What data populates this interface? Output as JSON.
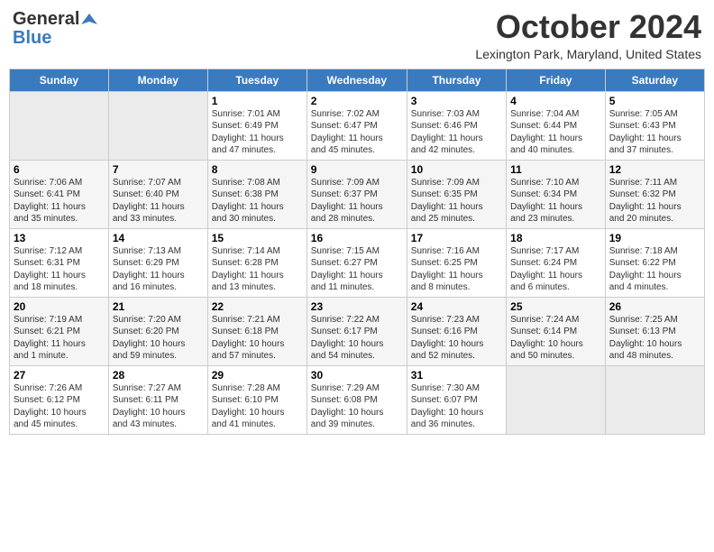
{
  "header": {
    "logo_general": "General",
    "logo_blue": "Blue",
    "month_title": "October 2024",
    "location": "Lexington Park, Maryland, United States"
  },
  "days_of_week": [
    "Sunday",
    "Monday",
    "Tuesday",
    "Wednesday",
    "Thursday",
    "Friday",
    "Saturday"
  ],
  "weeks": [
    [
      {
        "num": "",
        "info": ""
      },
      {
        "num": "",
        "info": ""
      },
      {
        "num": "1",
        "info": "Sunrise: 7:01 AM\nSunset: 6:49 PM\nDaylight: 11 hours\nand 47 minutes."
      },
      {
        "num": "2",
        "info": "Sunrise: 7:02 AM\nSunset: 6:47 PM\nDaylight: 11 hours\nand 45 minutes."
      },
      {
        "num": "3",
        "info": "Sunrise: 7:03 AM\nSunset: 6:46 PM\nDaylight: 11 hours\nand 42 minutes."
      },
      {
        "num": "4",
        "info": "Sunrise: 7:04 AM\nSunset: 6:44 PM\nDaylight: 11 hours\nand 40 minutes."
      },
      {
        "num": "5",
        "info": "Sunrise: 7:05 AM\nSunset: 6:43 PM\nDaylight: 11 hours\nand 37 minutes."
      }
    ],
    [
      {
        "num": "6",
        "info": "Sunrise: 7:06 AM\nSunset: 6:41 PM\nDaylight: 11 hours\nand 35 minutes."
      },
      {
        "num": "7",
        "info": "Sunrise: 7:07 AM\nSunset: 6:40 PM\nDaylight: 11 hours\nand 33 minutes."
      },
      {
        "num": "8",
        "info": "Sunrise: 7:08 AM\nSunset: 6:38 PM\nDaylight: 11 hours\nand 30 minutes."
      },
      {
        "num": "9",
        "info": "Sunrise: 7:09 AM\nSunset: 6:37 PM\nDaylight: 11 hours\nand 28 minutes."
      },
      {
        "num": "10",
        "info": "Sunrise: 7:09 AM\nSunset: 6:35 PM\nDaylight: 11 hours\nand 25 minutes."
      },
      {
        "num": "11",
        "info": "Sunrise: 7:10 AM\nSunset: 6:34 PM\nDaylight: 11 hours\nand 23 minutes."
      },
      {
        "num": "12",
        "info": "Sunrise: 7:11 AM\nSunset: 6:32 PM\nDaylight: 11 hours\nand 20 minutes."
      }
    ],
    [
      {
        "num": "13",
        "info": "Sunrise: 7:12 AM\nSunset: 6:31 PM\nDaylight: 11 hours\nand 18 minutes."
      },
      {
        "num": "14",
        "info": "Sunrise: 7:13 AM\nSunset: 6:29 PM\nDaylight: 11 hours\nand 16 minutes."
      },
      {
        "num": "15",
        "info": "Sunrise: 7:14 AM\nSunset: 6:28 PM\nDaylight: 11 hours\nand 13 minutes."
      },
      {
        "num": "16",
        "info": "Sunrise: 7:15 AM\nSunset: 6:27 PM\nDaylight: 11 hours\nand 11 minutes."
      },
      {
        "num": "17",
        "info": "Sunrise: 7:16 AM\nSunset: 6:25 PM\nDaylight: 11 hours\nand 8 minutes."
      },
      {
        "num": "18",
        "info": "Sunrise: 7:17 AM\nSunset: 6:24 PM\nDaylight: 11 hours\nand 6 minutes."
      },
      {
        "num": "19",
        "info": "Sunrise: 7:18 AM\nSunset: 6:22 PM\nDaylight: 11 hours\nand 4 minutes."
      }
    ],
    [
      {
        "num": "20",
        "info": "Sunrise: 7:19 AM\nSunset: 6:21 PM\nDaylight: 11 hours\nand 1 minute."
      },
      {
        "num": "21",
        "info": "Sunrise: 7:20 AM\nSunset: 6:20 PM\nDaylight: 10 hours\nand 59 minutes."
      },
      {
        "num": "22",
        "info": "Sunrise: 7:21 AM\nSunset: 6:18 PM\nDaylight: 10 hours\nand 57 minutes."
      },
      {
        "num": "23",
        "info": "Sunrise: 7:22 AM\nSunset: 6:17 PM\nDaylight: 10 hours\nand 54 minutes."
      },
      {
        "num": "24",
        "info": "Sunrise: 7:23 AM\nSunset: 6:16 PM\nDaylight: 10 hours\nand 52 minutes."
      },
      {
        "num": "25",
        "info": "Sunrise: 7:24 AM\nSunset: 6:14 PM\nDaylight: 10 hours\nand 50 minutes."
      },
      {
        "num": "26",
        "info": "Sunrise: 7:25 AM\nSunset: 6:13 PM\nDaylight: 10 hours\nand 48 minutes."
      }
    ],
    [
      {
        "num": "27",
        "info": "Sunrise: 7:26 AM\nSunset: 6:12 PM\nDaylight: 10 hours\nand 45 minutes."
      },
      {
        "num": "28",
        "info": "Sunrise: 7:27 AM\nSunset: 6:11 PM\nDaylight: 10 hours\nand 43 minutes."
      },
      {
        "num": "29",
        "info": "Sunrise: 7:28 AM\nSunset: 6:10 PM\nDaylight: 10 hours\nand 41 minutes."
      },
      {
        "num": "30",
        "info": "Sunrise: 7:29 AM\nSunset: 6:08 PM\nDaylight: 10 hours\nand 39 minutes."
      },
      {
        "num": "31",
        "info": "Sunrise: 7:30 AM\nSunset: 6:07 PM\nDaylight: 10 hours\nand 36 minutes."
      },
      {
        "num": "",
        "info": ""
      },
      {
        "num": "",
        "info": ""
      }
    ]
  ]
}
